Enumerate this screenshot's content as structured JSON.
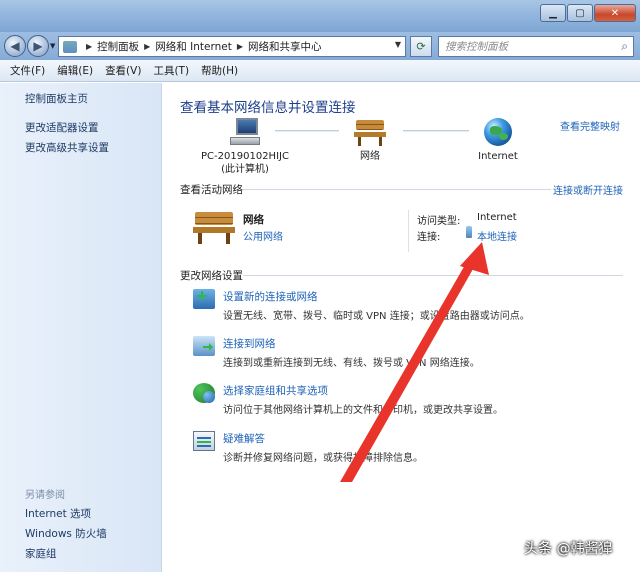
{
  "address": {
    "crumbs": [
      "控制面板",
      "网络和 Internet",
      "网络和共享中心"
    ]
  },
  "search": {
    "placeholder": "搜索控制面板"
  },
  "menu": [
    "文件(F)",
    "编辑(E)",
    "查看(V)",
    "工具(T)",
    "帮助(H)"
  ],
  "sidebar": {
    "links": [
      "控制面板主页",
      "更改适配器设置",
      "更改高级共享设置"
    ],
    "see_also_title": "另请参阅",
    "see_also": [
      "Internet 选项",
      "Windows 防火墙",
      "家庭组"
    ]
  },
  "main": {
    "title": "查看基本网络信息并设置连接",
    "full_map": "查看完整映射",
    "nodes": {
      "pc_name": "PC-20190102HIJC",
      "pc_sub": "(此计算机)",
      "network": "网络",
      "internet": "Internet"
    },
    "active_title": "查看活动网络",
    "connect_disconnect": "连接或断开连接",
    "active": {
      "name": "网络",
      "type": "公用网络",
      "access_label": "访问类型:",
      "access_value": "Internet",
      "connection_label": "连接:",
      "connection_value": "本地连接"
    },
    "change_title": "更改网络设置",
    "tasks": [
      {
        "title": "设置新的连接或网络",
        "desc": "设置无线、宽带、拨号、临时或 VPN 连接；或设置路由器或访问点。",
        "icon": "network-setup-icon"
      },
      {
        "title": "连接到网络",
        "desc": "连接到或重新连接到无线、有线、拨号或 VPN 网络连接。",
        "icon": "connect-network-icon"
      },
      {
        "title": "选择家庭组和共享选项",
        "desc": "访问位于其他网络计算机上的文件和打印机，或更改共享设置。",
        "icon": "homegroup-icon"
      },
      {
        "title": "疑难解答",
        "desc": "诊断并修复网络问题，或获得故障排除信息。",
        "icon": "troubleshoot-icon"
      }
    ]
  },
  "watermark": "头条 @韩酱獋",
  "colors": {
    "link": "#1f63b8",
    "title": "#1e3f8a",
    "arrow": "#e8342a"
  }
}
